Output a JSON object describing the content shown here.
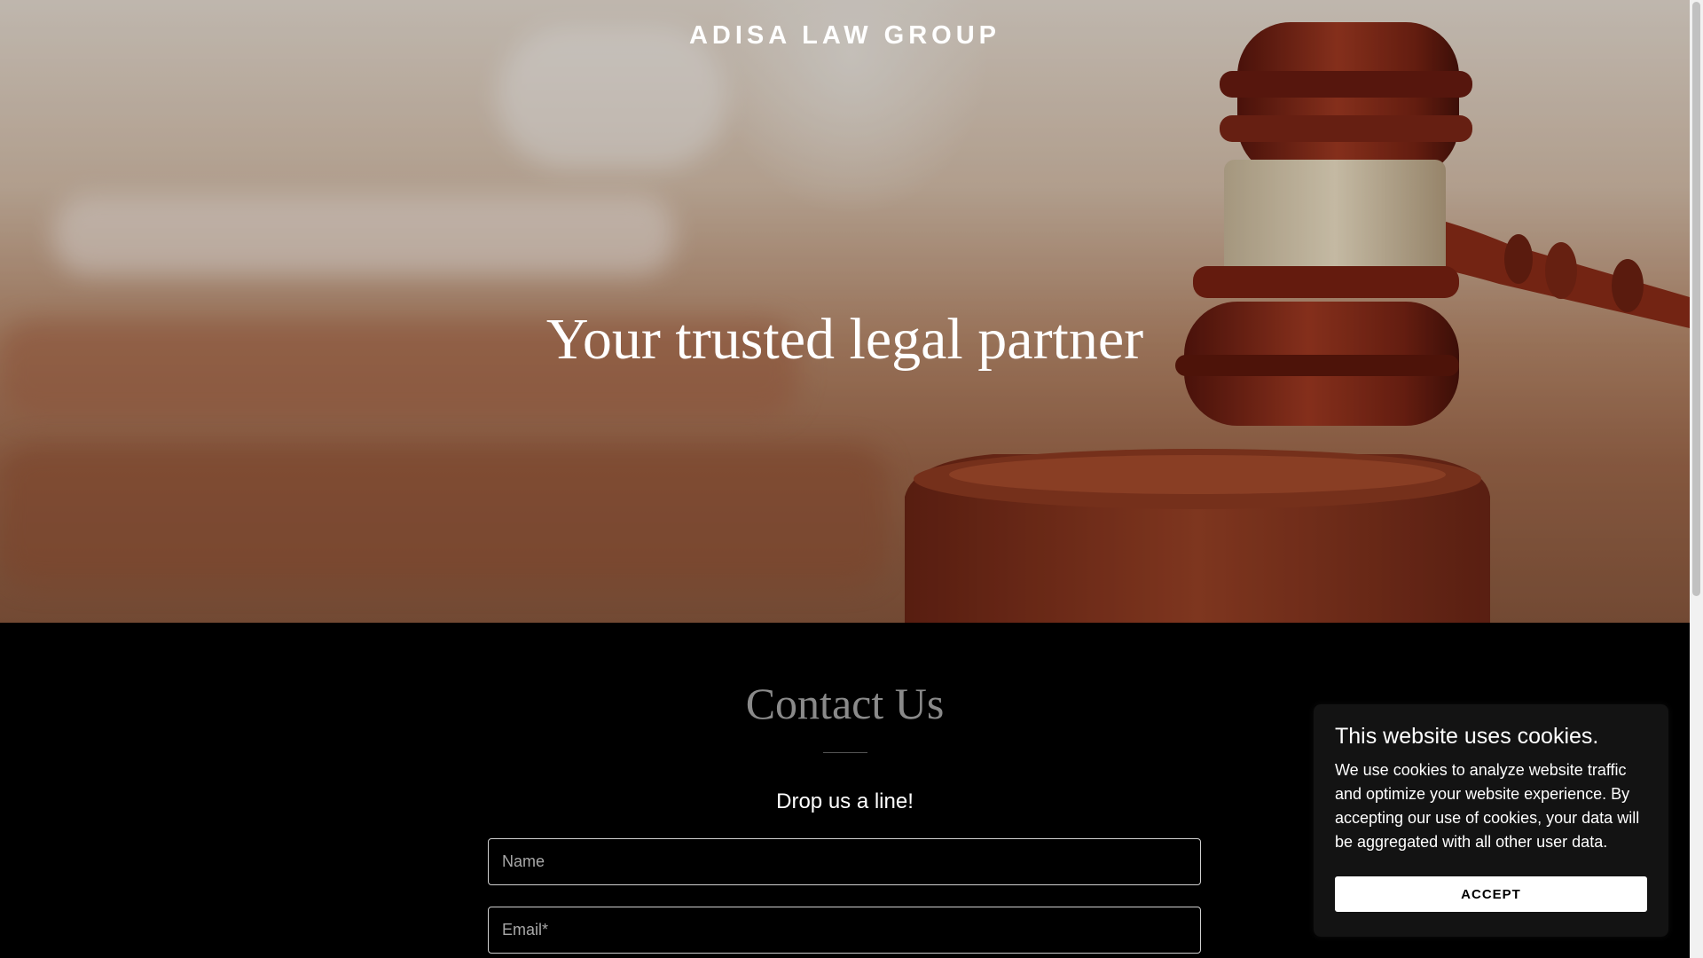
{
  "header": {
    "brand": "ADISA LAW GROUP"
  },
  "hero": {
    "tagline": "Your trusted legal partner"
  },
  "contact": {
    "title": "Contact Us",
    "subtitle": "Drop us a line!",
    "fields": {
      "name_placeholder": "Name",
      "email_placeholder": "Email*"
    }
  },
  "cookie_banner": {
    "title": "This website uses cookies.",
    "text": "We use cookies to analyze website traffic and optimize your website experience. By accepting our use of cookies, your data will be aggregated with all other user data.",
    "accept_label": "ACCEPT"
  },
  "colors": {
    "background": "#000000",
    "hero_wood": "#7a2a1a",
    "accept_button": "#ffffff"
  }
}
